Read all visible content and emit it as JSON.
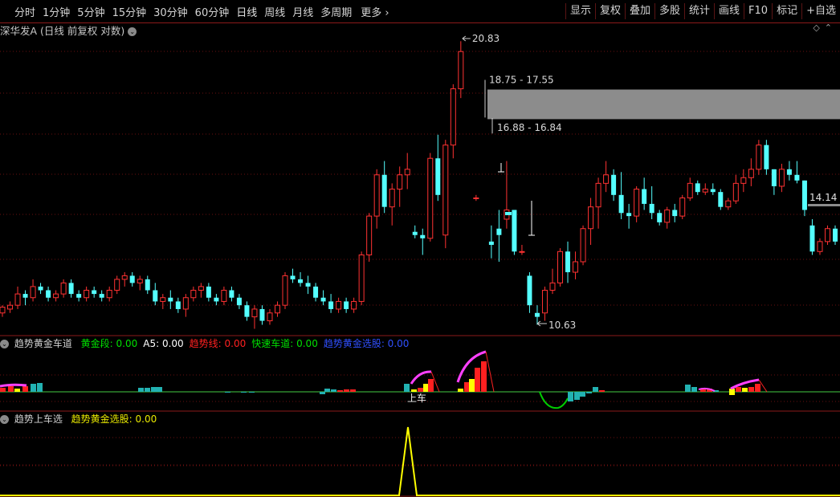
{
  "toolbar": {
    "periods": [
      {
        "label": "分时",
        "active": false
      },
      {
        "label": "1分钟",
        "active": false
      },
      {
        "label": "5分钟",
        "active": false
      },
      {
        "label": "15分钟",
        "active": false
      },
      {
        "label": "30分钟",
        "active": false
      },
      {
        "label": "60分钟",
        "active": false
      },
      {
        "label": "日线",
        "active": true
      },
      {
        "label": "周线",
        "active": false
      },
      {
        "label": "月线",
        "active": false
      },
      {
        "label": "多周期",
        "active": false
      }
    ],
    "more_label": "更多",
    "right_buttons": [
      "显示",
      "复权",
      "叠加",
      "多股",
      "统计",
      "画线",
      "F10",
      "标记",
      "+自选"
    ]
  },
  "main_chart": {
    "title": "深华发A",
    "subtitle": "(日线 前复权 对数)",
    "colors": {
      "up": "#ff3232",
      "down": "#54ffff",
      "grid": "#6a1010"
    },
    "annotations": {
      "high_label": "20.83",
      "low_label": "10.63",
      "zone_top_label": "18.75 - 17.55",
      "zone_bottom_label": "16.88 - 16.84",
      "price_tag": "14.14"
    },
    "candles": [
      [
        10.9,
        11.1,
        10.8,
        11.05
      ],
      [
        11.0,
        11.2,
        10.9,
        11.1
      ],
      [
        11.1,
        11.6,
        11.0,
        11.4
      ],
      [
        11.4,
        11.5,
        11.1,
        11.3
      ],
      [
        11.3,
        11.8,
        11.2,
        11.6
      ],
      [
        11.6,
        11.7,
        11.4,
        11.5
      ],
      [
        11.5,
        11.6,
        11.2,
        11.3
      ],
      [
        11.3,
        11.5,
        11.2,
        11.4
      ],
      [
        11.4,
        11.8,
        11.3,
        11.7
      ],
      [
        11.7,
        11.8,
        11.3,
        11.4
      ],
      [
        11.4,
        11.5,
        11.2,
        11.3
      ],
      [
        11.3,
        11.6,
        11.2,
        11.5
      ],
      [
        11.5,
        11.6,
        11.3,
        11.4
      ],
      [
        11.4,
        11.5,
        11.2,
        11.3
      ],
      [
        11.3,
        11.6,
        11.2,
        11.5
      ],
      [
        11.5,
        11.9,
        11.4,
        11.8
      ],
      [
        11.8,
        12.0,
        11.6,
        11.9
      ],
      [
        11.9,
        12.0,
        11.6,
        11.7
      ],
      [
        11.7,
        11.9,
        11.5,
        11.8
      ],
      [
        11.8,
        11.9,
        11.4,
        11.5
      ],
      [
        11.5,
        11.7,
        11.1,
        11.2
      ],
      [
        11.2,
        11.4,
        11.0,
        11.3
      ],
      [
        11.3,
        11.5,
        11.0,
        11.2
      ],
      [
        11.2,
        11.3,
        10.9,
        11.0
      ],
      [
        11.0,
        11.4,
        10.8,
        11.3
      ],
      [
        11.3,
        11.6,
        11.2,
        11.5
      ],
      [
        11.5,
        11.7,
        11.3,
        11.6
      ],
      [
        11.6,
        11.7,
        11.2,
        11.3
      ],
      [
        11.3,
        11.4,
        11.1,
        11.2
      ],
      [
        11.2,
        11.6,
        11.1,
        11.5
      ],
      [
        11.5,
        11.6,
        11.2,
        11.3
      ],
      [
        11.3,
        11.4,
        11.0,
        11.1
      ],
      [
        11.1,
        11.2,
        10.7,
        10.8
      ],
      [
        10.8,
        11.1,
        10.5,
        11.0
      ],
      [
        11.0,
        11.1,
        10.6,
        10.7
      ],
      [
        10.7,
        11.0,
        10.6,
        10.9
      ],
      [
        10.9,
        11.2,
        10.8,
        11.1
      ],
      [
        11.1,
        12.0,
        11.0,
        11.9
      ],
      [
        11.9,
        12.1,
        11.7,
        11.8
      ],
      [
        11.8,
        12.0,
        11.6,
        11.7
      ],
      [
        11.7,
        11.9,
        11.4,
        11.6
      ],
      [
        11.6,
        11.7,
        11.2,
        11.3
      ],
      [
        11.3,
        11.5,
        11.1,
        11.2
      ],
      [
        11.2,
        11.4,
        10.9,
        11.0
      ],
      [
        11.0,
        11.3,
        10.9,
        11.2
      ],
      [
        11.2,
        11.3,
        10.9,
        11.0
      ],
      [
        11.0,
        11.3,
        10.9,
        11.2
      ],
      [
        11.2,
        12.6,
        11.1,
        12.5
      ],
      [
        12.5,
        13.8,
        12.3,
        13.7
      ],
      [
        13.7,
        15.3,
        13.3,
        15.1
      ],
      [
        15.1,
        15.6,
        13.8,
        14.0
      ],
      [
        14.0,
        14.8,
        13.4,
        14.6
      ],
      [
        14.6,
        15.4,
        14.0,
        15.1
      ],
      [
        15.1,
        15.9,
        14.6,
        15.3
      ],
      [
        13.2,
        13.4,
        13.0,
        13.1
      ],
      [
        13.1,
        13.3,
        12.5,
        13.0
      ],
      [
        13.0,
        15.9,
        12.9,
        15.7
      ],
      [
        15.7,
        16.6,
        14.2,
        14.4
      ],
      [
        13.1,
        16.4,
        12.7,
        16.2
      ],
      [
        16.2,
        18.7,
        15.7,
        18.5
      ],
      [
        18.5,
        20.7,
        18.1,
        20.2
      ],
      [
        null
      ],
      [
        14.3,
        14.4,
        14.2,
        14.3
      ],
      [
        null
      ],
      [
        12.9,
        13.4,
        12.4,
        12.8
      ],
      [
        13.3,
        13.9,
        12.3,
        13.1
      ],
      [
        13.6,
        15.6,
        13.3,
        13.9
      ],
      [
        13.9,
        13.9,
        12.5,
        12.6
      ],
      [
        12.6,
        12.8,
        12.5,
        12.6
      ],
      [
        11.9,
        12.0,
        10.9,
        11.1
      ],
      [
        10.9,
        11.1,
        10.6,
        10.8
      ],
      [
        10.9,
        11.6,
        10.7,
        11.5
      ],
      [
        11.5,
        12.1,
        11.4,
        11.7
      ],
      [
        11.7,
        12.7,
        11.6,
        12.6
      ],
      [
        12.6,
        12.9,
        11.7,
        12.0
      ],
      [
        12.0,
        12.6,
        11.8,
        12.3
      ],
      [
        12.3,
        13.4,
        12.2,
        13.3
      ],
      [
        13.3,
        14.3,
        12.8,
        14.0
      ],
      [
        14.0,
        15.0,
        13.3,
        14.8
      ],
      [
        14.8,
        15.6,
        14.5,
        15.1
      ],
      [
        15.1,
        15.3,
        14.2,
        14.4
      ],
      [
        14.4,
        15.2,
        13.6,
        13.8
      ],
      [
        13.8,
        14.1,
        13.3,
        13.7
      ],
      [
        13.7,
        14.7,
        13.5,
        14.6
      ],
      [
        14.6,
        15.0,
        13.9,
        14.1
      ],
      [
        14.1,
        14.7,
        13.6,
        13.8
      ],
      [
        13.8,
        13.9,
        13.4,
        13.5
      ],
      [
        13.5,
        14.0,
        13.3,
        13.9
      ],
      [
        13.9,
        14.1,
        13.5,
        13.7
      ],
      [
        13.7,
        14.4,
        13.6,
        14.3
      ],
      [
        14.3,
        15.0,
        14.2,
        14.8
      ],
      [
        14.8,
        14.9,
        14.4,
        14.5
      ],
      [
        14.5,
        14.8,
        14.4,
        14.6
      ],
      [
        14.6,
        14.8,
        14.4,
        14.5
      ],
      [
        14.5,
        14.6,
        13.9,
        14.0
      ],
      [
        14.0,
        14.3,
        13.9,
        14.2
      ],
      [
        14.2,
        15.1,
        14.1,
        14.8
      ],
      [
        14.8,
        15.3,
        14.5,
        15.0
      ],
      [
        15.0,
        15.7,
        14.7,
        15.3
      ],
      [
        15.3,
        16.4,
        15.1,
        16.2
      ],
      [
        16.2,
        16.4,
        15.1,
        15.3
      ],
      [
        15.3,
        15.3,
        14.4,
        14.7
      ],
      [
        14.7,
        15.5,
        14.5,
        15.3
      ],
      [
        15.3,
        15.6,
        14.9,
        15.1
      ],
      [
        15.1,
        15.6,
        14.8,
        14.9
      ],
      [
        14.9,
        14.9,
        13.7,
        13.9
      ],
      [
        13.4,
        13.6,
        12.5,
        12.6
      ],
      [
        12.6,
        13.0,
        12.5,
        12.9
      ],
      [
        12.9,
        13.4,
        12.8,
        13.3
      ],
      [
        13.3,
        13.4,
        12.8,
        12.9
      ]
    ]
  },
  "indicator1": {
    "title": "趋势黄金车道",
    "labels": [
      {
        "text": "黄金段: 0.00",
        "color": "#00e000"
      },
      {
        "text": "A5: 0.00",
        "color": "#ffffff"
      },
      {
        "text": "趋势线: 0.00",
        "color": "#ff2020"
      },
      {
        "text": "快速车道: 0.00",
        "color": "#00e000"
      },
      {
        "text": "趋势黄金选股: 0.00",
        "color": "#3050ff"
      }
    ],
    "signal_text": "上车"
  },
  "indicator2": {
    "title": "趋势上车选",
    "labels": [
      {
        "text": "趋势黄金选股: 0.00",
        "color": "#e8e800"
      }
    ]
  }
}
